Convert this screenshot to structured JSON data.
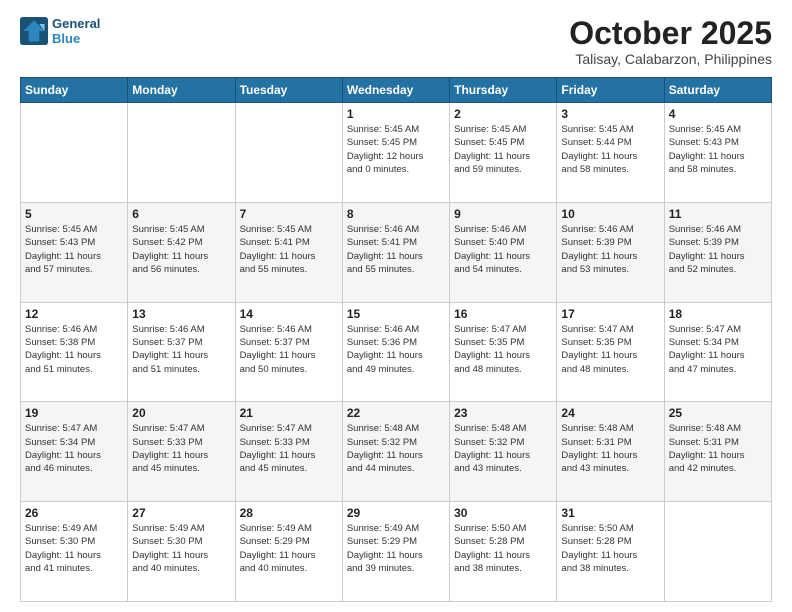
{
  "header": {
    "logo_line1": "General",
    "logo_line2": "Blue",
    "month": "October 2025",
    "location": "Talisay, Calabarzon, Philippines"
  },
  "days_of_week": [
    "Sunday",
    "Monday",
    "Tuesday",
    "Wednesday",
    "Thursday",
    "Friday",
    "Saturday"
  ],
  "weeks": [
    [
      {
        "day": "",
        "info": ""
      },
      {
        "day": "",
        "info": ""
      },
      {
        "day": "",
        "info": ""
      },
      {
        "day": "1",
        "info": "Sunrise: 5:45 AM\nSunset: 5:45 PM\nDaylight: 12 hours\nand 0 minutes."
      },
      {
        "day": "2",
        "info": "Sunrise: 5:45 AM\nSunset: 5:45 PM\nDaylight: 11 hours\nand 59 minutes."
      },
      {
        "day": "3",
        "info": "Sunrise: 5:45 AM\nSunset: 5:44 PM\nDaylight: 11 hours\nand 58 minutes."
      },
      {
        "day": "4",
        "info": "Sunrise: 5:45 AM\nSunset: 5:43 PM\nDaylight: 11 hours\nand 58 minutes."
      }
    ],
    [
      {
        "day": "5",
        "info": "Sunrise: 5:45 AM\nSunset: 5:43 PM\nDaylight: 11 hours\nand 57 minutes."
      },
      {
        "day": "6",
        "info": "Sunrise: 5:45 AM\nSunset: 5:42 PM\nDaylight: 11 hours\nand 56 minutes."
      },
      {
        "day": "7",
        "info": "Sunrise: 5:45 AM\nSunset: 5:41 PM\nDaylight: 11 hours\nand 55 minutes."
      },
      {
        "day": "8",
        "info": "Sunrise: 5:46 AM\nSunset: 5:41 PM\nDaylight: 11 hours\nand 55 minutes."
      },
      {
        "day": "9",
        "info": "Sunrise: 5:46 AM\nSunset: 5:40 PM\nDaylight: 11 hours\nand 54 minutes."
      },
      {
        "day": "10",
        "info": "Sunrise: 5:46 AM\nSunset: 5:39 PM\nDaylight: 11 hours\nand 53 minutes."
      },
      {
        "day": "11",
        "info": "Sunrise: 5:46 AM\nSunset: 5:39 PM\nDaylight: 11 hours\nand 52 minutes."
      }
    ],
    [
      {
        "day": "12",
        "info": "Sunrise: 5:46 AM\nSunset: 5:38 PM\nDaylight: 11 hours\nand 51 minutes."
      },
      {
        "day": "13",
        "info": "Sunrise: 5:46 AM\nSunset: 5:37 PM\nDaylight: 11 hours\nand 51 minutes."
      },
      {
        "day": "14",
        "info": "Sunrise: 5:46 AM\nSunset: 5:37 PM\nDaylight: 11 hours\nand 50 minutes."
      },
      {
        "day": "15",
        "info": "Sunrise: 5:46 AM\nSunset: 5:36 PM\nDaylight: 11 hours\nand 49 minutes."
      },
      {
        "day": "16",
        "info": "Sunrise: 5:47 AM\nSunset: 5:35 PM\nDaylight: 11 hours\nand 48 minutes."
      },
      {
        "day": "17",
        "info": "Sunrise: 5:47 AM\nSunset: 5:35 PM\nDaylight: 11 hours\nand 48 minutes."
      },
      {
        "day": "18",
        "info": "Sunrise: 5:47 AM\nSunset: 5:34 PM\nDaylight: 11 hours\nand 47 minutes."
      }
    ],
    [
      {
        "day": "19",
        "info": "Sunrise: 5:47 AM\nSunset: 5:34 PM\nDaylight: 11 hours\nand 46 minutes."
      },
      {
        "day": "20",
        "info": "Sunrise: 5:47 AM\nSunset: 5:33 PM\nDaylight: 11 hours\nand 45 minutes."
      },
      {
        "day": "21",
        "info": "Sunrise: 5:47 AM\nSunset: 5:33 PM\nDaylight: 11 hours\nand 45 minutes."
      },
      {
        "day": "22",
        "info": "Sunrise: 5:48 AM\nSunset: 5:32 PM\nDaylight: 11 hours\nand 44 minutes."
      },
      {
        "day": "23",
        "info": "Sunrise: 5:48 AM\nSunset: 5:32 PM\nDaylight: 11 hours\nand 43 minutes."
      },
      {
        "day": "24",
        "info": "Sunrise: 5:48 AM\nSunset: 5:31 PM\nDaylight: 11 hours\nand 43 minutes."
      },
      {
        "day": "25",
        "info": "Sunrise: 5:48 AM\nSunset: 5:31 PM\nDaylight: 11 hours\nand 42 minutes."
      }
    ],
    [
      {
        "day": "26",
        "info": "Sunrise: 5:49 AM\nSunset: 5:30 PM\nDaylight: 11 hours\nand 41 minutes."
      },
      {
        "day": "27",
        "info": "Sunrise: 5:49 AM\nSunset: 5:30 PM\nDaylight: 11 hours\nand 40 minutes."
      },
      {
        "day": "28",
        "info": "Sunrise: 5:49 AM\nSunset: 5:29 PM\nDaylight: 11 hours\nand 40 minutes."
      },
      {
        "day": "29",
        "info": "Sunrise: 5:49 AM\nSunset: 5:29 PM\nDaylight: 11 hours\nand 39 minutes."
      },
      {
        "day": "30",
        "info": "Sunrise: 5:50 AM\nSunset: 5:28 PM\nDaylight: 11 hours\nand 38 minutes."
      },
      {
        "day": "31",
        "info": "Sunrise: 5:50 AM\nSunset: 5:28 PM\nDaylight: 11 hours\nand 38 minutes."
      },
      {
        "day": "",
        "info": ""
      }
    ]
  ]
}
